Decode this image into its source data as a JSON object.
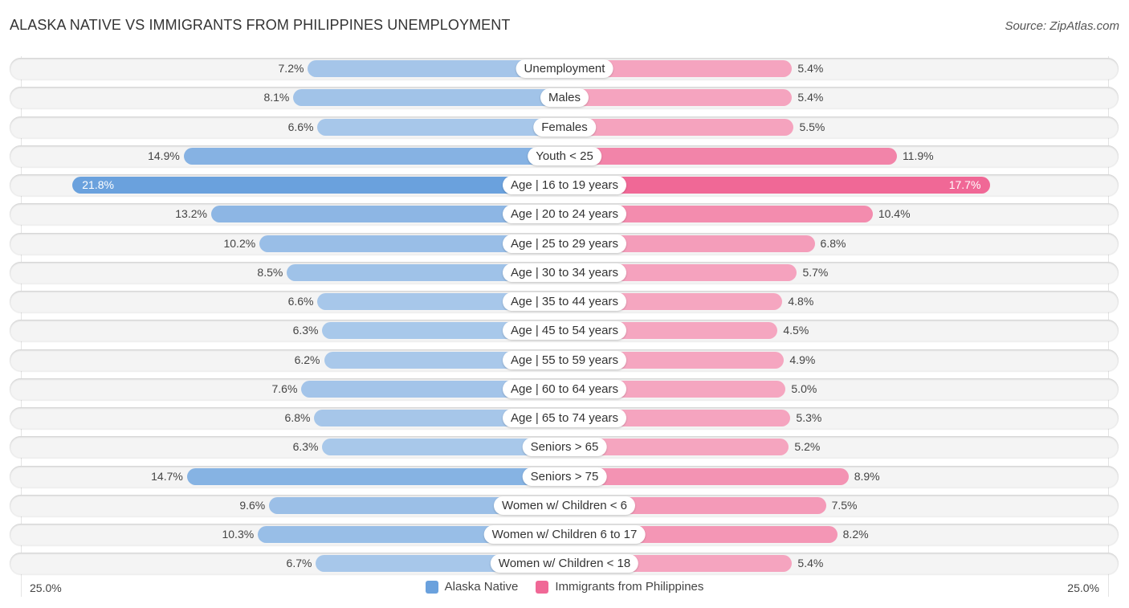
{
  "header": {
    "title": "ALASKA NATIVE VS IMMIGRANTS FROM PHILIPPINES UNEMPLOYMENT",
    "source": "Source: ZipAtlas.com"
  },
  "colors": {
    "left_series": "#6aa1dd",
    "left_series_light": "#a9c8ea",
    "right_series": "#f06896",
    "right_series_light": "#f5a6c0"
  },
  "chart_data": {
    "type": "bar",
    "orientation": "horizontal-diverging",
    "title": "ALASKA NATIVE VS IMMIGRANTS FROM PHILIPPINES UNEMPLOYMENT",
    "xlabel": "",
    "ylabel": "",
    "xlim": [
      0,
      25.0
    ],
    "axis_left_label": "25.0%",
    "axis_right_label": "25.0%",
    "legend_position": "bottom-center",
    "categories": [
      "Unemployment",
      "Males",
      "Females",
      "Youth < 25",
      "Age | 16 to 19 years",
      "Age | 20 to 24 years",
      "Age | 25 to 29 years",
      "Age | 30 to 34 years",
      "Age | 35 to 44 years",
      "Age | 45 to 54 years",
      "Age | 55 to 59 years",
      "Age | 60 to 64 years",
      "Age | 65 to 74 years",
      "Seniors > 65",
      "Seniors > 75",
      "Women w/ Children < 6",
      "Women w/ Children 6 to 17",
      "Women w/ Children < 18"
    ],
    "series": [
      {
        "name": "Alaska Native",
        "side": "left",
        "values": [
          7.2,
          8.1,
          6.6,
          14.9,
          21.8,
          13.2,
          10.2,
          8.5,
          6.6,
          6.3,
          6.2,
          7.6,
          6.8,
          6.3,
          14.7,
          9.6,
          10.3,
          6.7
        ],
        "labels": [
          "7.2%",
          "8.1%",
          "6.6%",
          "14.9%",
          "21.8%",
          "13.2%",
          "10.2%",
          "8.5%",
          "6.6%",
          "6.3%",
          "6.2%",
          "7.6%",
          "6.8%",
          "6.3%",
          "14.7%",
          "9.6%",
          "10.3%",
          "6.7%"
        ]
      },
      {
        "name": "Immigrants from Philippines",
        "side": "right",
        "values": [
          5.4,
          5.4,
          5.5,
          11.9,
          17.7,
          10.4,
          6.8,
          5.7,
          4.8,
          4.5,
          4.9,
          5.0,
          5.3,
          5.2,
          8.9,
          7.5,
          8.2,
          5.4
        ],
        "labels": [
          "5.4%",
          "5.4%",
          "5.5%",
          "11.9%",
          "17.7%",
          "10.4%",
          "6.8%",
          "5.7%",
          "4.8%",
          "4.5%",
          "4.9%",
          "5.0%",
          "5.3%",
          "5.2%",
          "8.9%",
          "7.5%",
          "8.2%",
          "5.4%"
        ]
      }
    ]
  }
}
